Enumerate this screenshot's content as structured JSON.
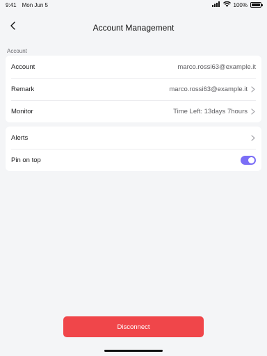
{
  "status_bar": {
    "time": "9:41",
    "date": "Mon Jun 5",
    "battery": "100%",
    "battery_level": 1.0
  },
  "header": {
    "title": "Account Management"
  },
  "section": {
    "label": "Account"
  },
  "group1": [
    {
      "label": "Account",
      "value": "marco.rossi63@example.it",
      "chevron": false
    },
    {
      "label": "Remark",
      "value": "marco.rossi63@example.it",
      "chevron": true
    },
    {
      "label": "Monitor",
      "value": "Time Left: 13days 7hours",
      "chevron": true
    }
  ],
  "group2": {
    "alerts": {
      "label": "Alerts"
    },
    "pin_on_top": {
      "label": "Pin on top",
      "enabled": true
    }
  },
  "footer": {
    "disconnect_label": "Disconnect"
  },
  "colors": {
    "accent": "#7b6ef6",
    "danger": "#f0464a",
    "background": "#f4f5f7"
  },
  "icons": [
    "back-chevron-icon",
    "signal-icon",
    "wifi-icon",
    "battery-icon",
    "chevron-right-icon"
  ]
}
